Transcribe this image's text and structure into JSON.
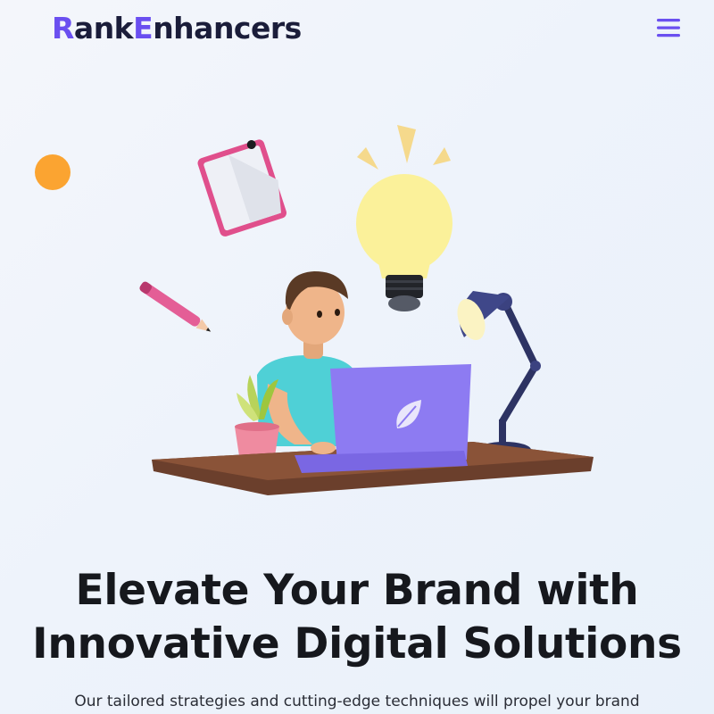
{
  "brand": {
    "logo_mark": "R",
    "name_part1": "ank ",
    "name_accent": "E",
    "name_part2": "nhancers",
    "accent_color": "#6a4ff0"
  },
  "header": {
    "menu_icon": "hamburger-menu-icon"
  },
  "hero": {
    "illustration": "person-working-on-laptop-illustration",
    "headline_line1": "Elevate Your Brand with",
    "headline_line2": "Innovative Digital Solutions",
    "subtext": "Our tailored strategies and cutting-edge techniques will propel your brand"
  },
  "colors": {
    "heading": "#16181d",
    "orange_dot": "#fba431",
    "laptop": "#8d7bf2",
    "shirt": "#4fd0d6",
    "desk": "#6b3f2c"
  }
}
